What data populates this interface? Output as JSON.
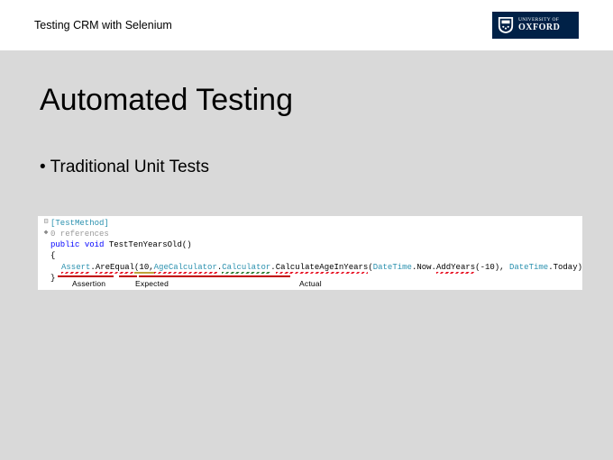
{
  "header": {
    "label": "Testing CRM with Selenium",
    "badge": {
      "line1": "UNIVERSITY OF",
      "line2": "OXFORD"
    }
  },
  "slide": {
    "title": "Automated Testing",
    "bullet": "• Traditional Unit Tests"
  },
  "code": {
    "attr": "[TestMethod]",
    "refs": "0 references",
    "kw_public": "public",
    "kw_void": "void",
    "method": "TestTenYearsOld()",
    "brace_open": "{",
    "assert": "Assert",
    "dot": ".",
    "areequal": "AreEqual",
    "open_args": "(10, ",
    "calc1": "AgeCalculator",
    "calc2": "Calculator",
    "calc3": "CalculateAgeInYears",
    "paren_open": "(",
    "dt": "DateTime",
    "now": ".Now.",
    "addyears": "AddYears",
    "arg": "(-10), ",
    "today": ".Today));",
    "brace_close": "}"
  },
  "annotations": {
    "assertion": "Assertion",
    "expected": "Expected",
    "actual": "Actual"
  }
}
